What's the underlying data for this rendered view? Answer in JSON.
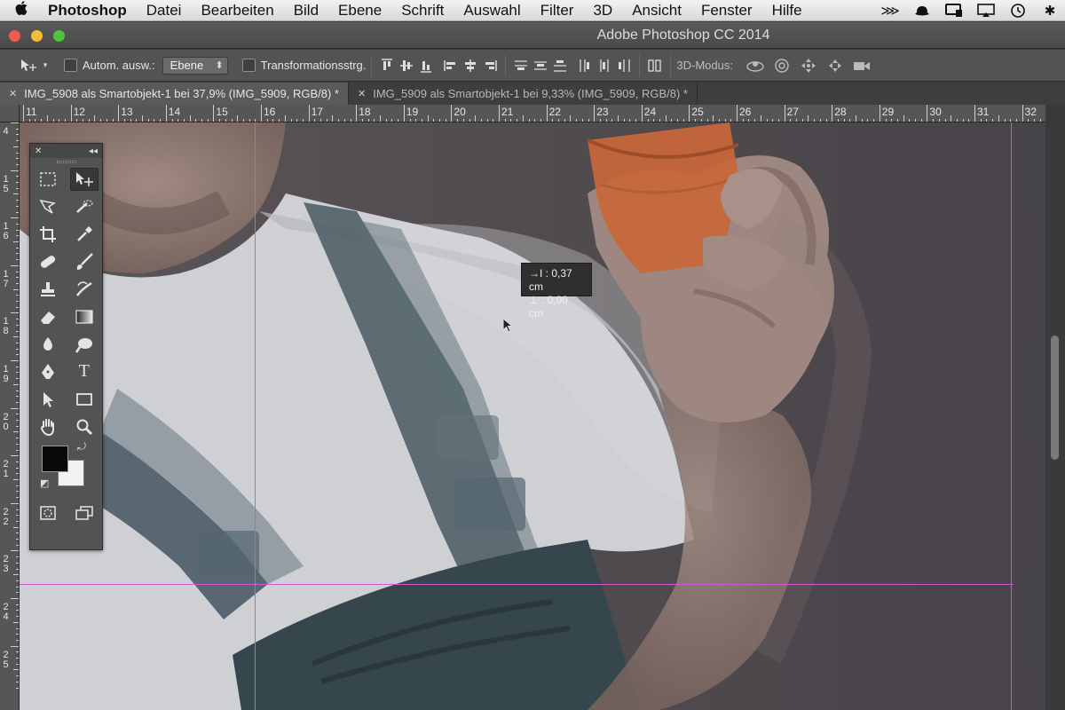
{
  "menubar": {
    "app": "Photoshop",
    "items": [
      "Datei",
      "Bearbeiten",
      "Bild",
      "Ebene",
      "Schrift",
      "Auswahl",
      "Filter",
      "3D",
      "Ansicht",
      "Fenster",
      "Hilfe"
    ],
    "status_icons": [
      "arrows-icon",
      "hat-icon",
      "monitor-icon",
      "airplay-icon",
      "time-machine-icon",
      "bluetooth-icon"
    ]
  },
  "window": {
    "title": "Adobe Photoshop CC 2014",
    "controls": {
      "close": "#ee5b52",
      "minimize": "#f4bd36",
      "maximize": "#52c23c"
    }
  },
  "options": {
    "auto_select_label": "Autom. ausw.:",
    "auto_select_value": "Ebene",
    "transform_label": "Transformationsstrg.",
    "mode_label": "3D-Modus:"
  },
  "tabs": [
    {
      "label": "IMG_5908 als Smartobjekt-1 bei 37,9% (IMG_5909, RGB/8) *",
      "active": true
    },
    {
      "label": "IMG_5909 als Smartobjekt-1 bei 9,33% (IMG_5909, RGB/8) *",
      "active": false
    }
  ],
  "ruler": {
    "h_labels": [
      "11",
      "12",
      "13",
      "14",
      "15",
      "16",
      "17",
      "18",
      "19",
      "20",
      "21",
      "22",
      "23",
      "24",
      "25",
      "26",
      "27",
      "28",
      "29",
      "30",
      "31",
      "32"
    ],
    "v_labels": [
      [
        "4"
      ],
      [
        "1",
        "5"
      ],
      [
        "1",
        "6"
      ],
      [
        "1",
        "7"
      ],
      [
        "1",
        "8"
      ],
      [
        "1",
        "9"
      ],
      [
        "2",
        "0"
      ],
      [
        "2",
        "1"
      ],
      [
        "2",
        "2"
      ],
      [
        "2",
        "3"
      ],
      [
        "2",
        "4"
      ],
      [
        "2",
        "5"
      ]
    ]
  },
  "tooltip": {
    "line1": "→I : 0,37 cm",
    "line2": "⊥ : 0,00 cm"
  },
  "colors": {
    "guide": "#d357d3",
    "foreground": "#0a0a0a",
    "background": "#f2f2f2",
    "pot": "#c9673a"
  }
}
